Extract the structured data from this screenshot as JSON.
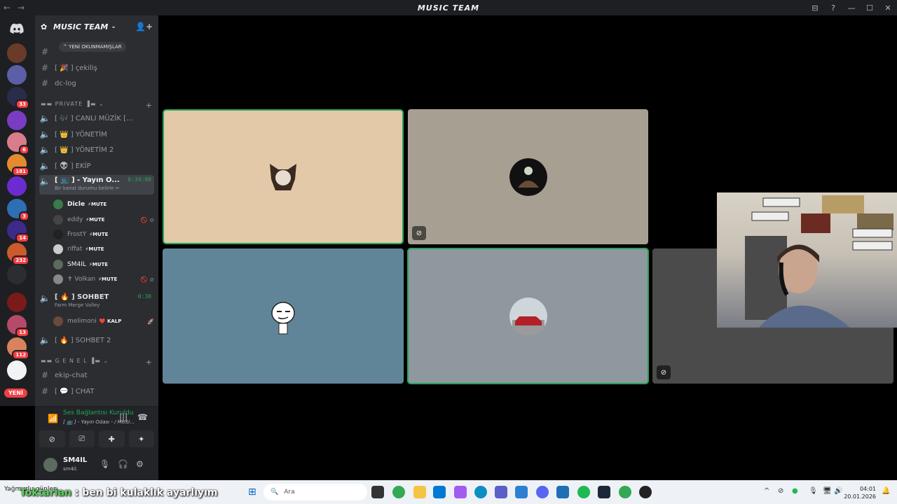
{
  "window": {
    "title": "MUSIC TEAM",
    "back": "←",
    "forward": "→",
    "controls": [
      "⊟",
      "?",
      "—",
      "☐",
      "✕"
    ]
  },
  "server": {
    "name": "MUSIC TEAM",
    "unread_pill": "^ YENİ OKUNMAMIŞLAR",
    "channels_top": [
      {
        "name": "[ 🎉 ] çekiliş",
        "type": "text"
      },
      {
        "name": "dc-log",
        "type": "text"
      }
    ],
    "category_private": "▬▬ PRIVATE ▐▬ ⌄",
    "voice_channels": [
      {
        "name": "[ 🎶 ] CANLI MÜZİK [...",
        "type": "voice"
      },
      {
        "name": "[ 👑 ] YÖNETİM",
        "type": "voice"
      },
      {
        "name": "[ 👑 ] YÖNETİM 2",
        "type": "voice"
      },
      {
        "name": "[ 👽 ] EKİP",
        "type": "voice"
      }
    ],
    "active_channel": {
      "name": "[ 📺 ] - Yayın O...",
      "time": "6:34:08",
      "status": "Bir kanal durumu belirle ✏"
    },
    "members": [
      {
        "name": "Dicle",
        "badge": "⚡MUTE",
        "avatar_color": "#3b7a4a"
      },
      {
        "name": "eddy",
        "badge": "⚡MUTE",
        "avatar_color": "#444",
        "icons": "🚫 ⊘"
      },
      {
        "name": "FrostY",
        "badge": "⚡MUTE",
        "avatar_color": "#222"
      },
      {
        "name": "riffat",
        "badge": "⚡MUTE",
        "avatar_color": "#ccc"
      },
      {
        "name": "SM4IL",
        "badge": "⚡MUTE",
        "avatar_color": "#5b6b5e"
      },
      {
        "name": "✝ Volkan",
        "badge": "⚡MUTE",
        "avatar_color": "#888",
        "icons": "🚫 ⊘"
      }
    ],
    "sohbet": {
      "name": "[ 🔥 ] SOHBET",
      "time": "0:30",
      "status": "Farm Merge Valley",
      "member": {
        "name": "melimoni",
        "badge": "❤️ KALP"
      }
    },
    "sohbet2": "[ 🔥 ] SOHBET 2",
    "category_genel": "▬▬ G E N E L ▐▬ ⌄",
    "text_channels": [
      {
        "name": "ekip-chat"
      },
      {
        "name": "[ 💬 ] CHAT"
      }
    ]
  },
  "guild_badges": [
    "33",
    "6",
    "181",
    "3",
    "14",
    "232",
    "13",
    "112"
  ],
  "guild_new": "YENİ",
  "voice_panel": {
    "status": "Ses Bağlantısı Kuruldu",
    "channel": "[ 📺 ] - Yayın Odası - / MUSI..."
  },
  "user_panel": {
    "name": "SM4IL",
    "handle": "sm4il."
  },
  "tiles": {
    "colors": {
      "t1": "#e3c9a8",
      "t2": "#a89f93",
      "t3": "#618598",
      "t4": "#8f979f",
      "t5": "#4b4b4b"
    }
  },
  "taskbar": {
    "news": "Yağmurlu günler...",
    "overlay_name": "Toktarian",
    "overlay_msg": " ben bi kulaklık ayarlıyım",
    "search_placeholder": "Ara",
    "time": "04:01",
    "date": "20.01.2026"
  }
}
